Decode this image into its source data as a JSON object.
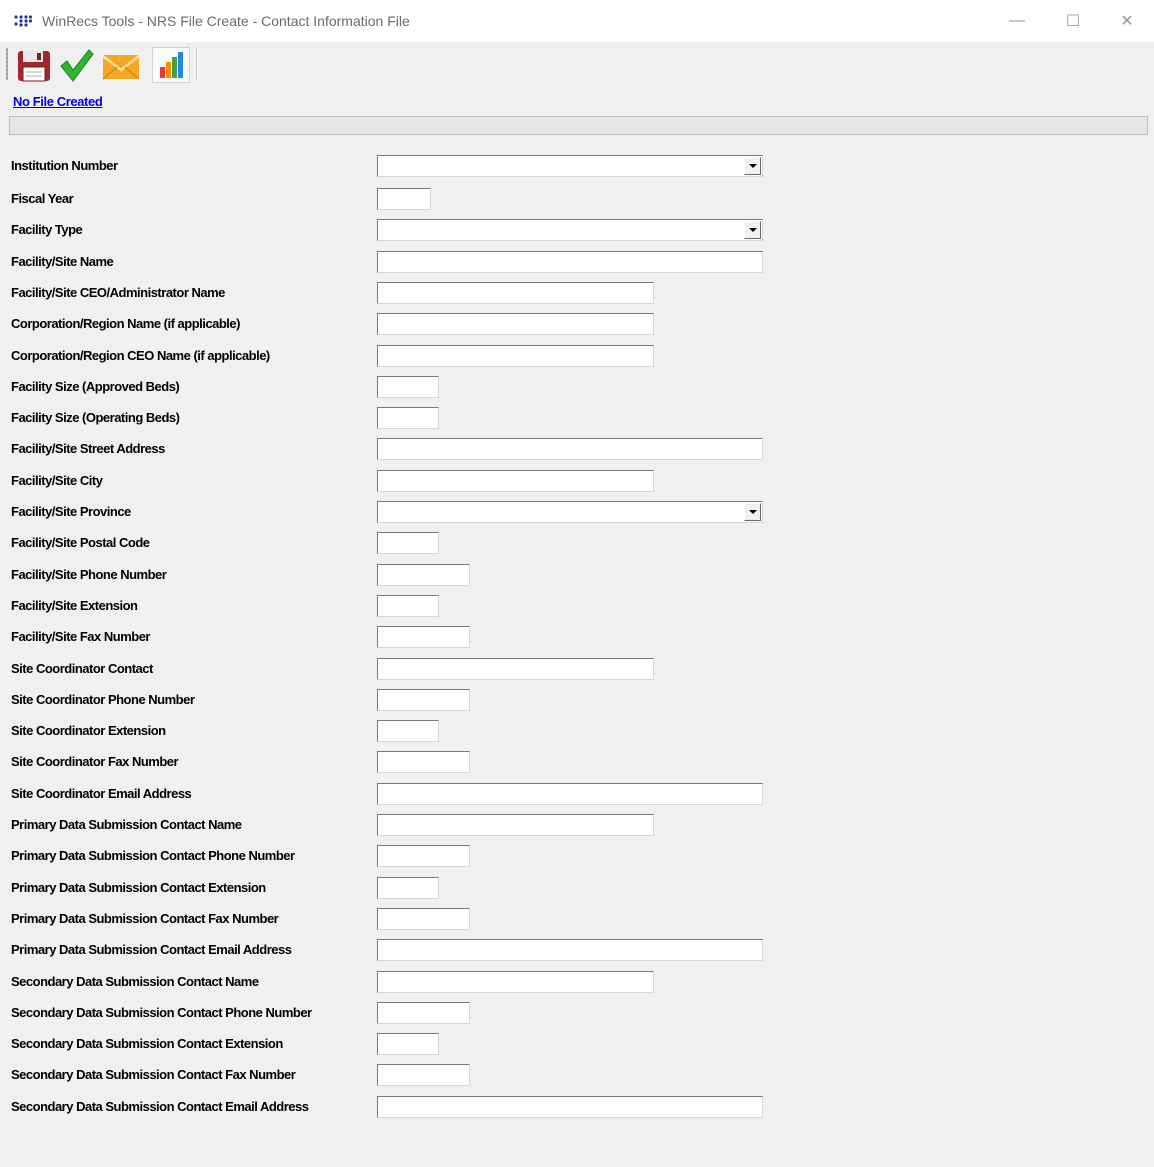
{
  "window": {
    "title": "WinRecs Tools - NRS File Create - Contact Information File",
    "minimize_glyph": "—",
    "maximize_glyph": "☐",
    "close_glyph": "✕"
  },
  "toolbar": {
    "buttons": [
      {
        "name": "save",
        "icon": "floppy-disk-icon"
      },
      {
        "name": "validate",
        "icon": "checkmark-icon"
      },
      {
        "name": "email",
        "icon": "envelope-icon"
      },
      {
        "name": "report",
        "icon": "bar-chart-icon"
      }
    ]
  },
  "status": {
    "link_text": "No File Created"
  },
  "form": {
    "fields": [
      {
        "label": "Institution Number",
        "value": ""
      },
      {
        "label": "Fiscal Year",
        "value": ""
      },
      {
        "label": "Facility Type",
        "value": ""
      },
      {
        "label": "Facility/Site Name",
        "value": ""
      },
      {
        "label": "Facility/Site CEO/Administrator Name",
        "value": ""
      },
      {
        "label": "Corporation/Region Name (if applicable)",
        "value": ""
      },
      {
        "label": "Corporation/Region CEO Name (if applicable)",
        "value": ""
      },
      {
        "label": "Facility Size (Approved Beds)",
        "value": ""
      },
      {
        "label": "Facility Size (Operating Beds)",
        "value": ""
      },
      {
        "label": "Facility/Site Street Address",
        "value": ""
      },
      {
        "label": "Facility/Site City",
        "value": ""
      },
      {
        "label": "Facility/Site Province",
        "value": ""
      },
      {
        "label": "Facility/Site Postal Code",
        "value": ""
      },
      {
        "label": "Facility/Site Phone Number",
        "value": ""
      },
      {
        "label": "Facility/Site Extension",
        "value": ""
      },
      {
        "label": "Facility/Site Fax Number",
        "value": ""
      },
      {
        "label": "Site Coordinator Contact",
        "value": ""
      },
      {
        "label": "Site Coordinator Phone Number",
        "value": ""
      },
      {
        "label": "Site Coordinator Extension",
        "value": ""
      },
      {
        "label": "Site Coordinator Fax Number",
        "value": ""
      },
      {
        "label": "Site Coordinator Email Address",
        "value": ""
      },
      {
        "label": "Primary Data Submission Contact Name",
        "value": ""
      },
      {
        "label": "Primary Data Submission Contact Phone Number",
        "value": ""
      },
      {
        "label": "Primary Data Submission Contact Extension",
        "value": ""
      },
      {
        "label": "Primary Data Submission Contact Fax Number",
        "value": ""
      },
      {
        "label": "Primary Data Submission Contact Email Address",
        "value": ""
      },
      {
        "label": "Secondary Data Submission Contact Name",
        "value": ""
      },
      {
        "label": "Secondary Data Submission Contact Phone Number",
        "value": ""
      },
      {
        "label": "Secondary Data Submission Contact Extension",
        "value": ""
      },
      {
        "label": "Secondary Data Submission Contact Fax Number",
        "value": ""
      },
      {
        "label": "Secondary Data Submission Contact Email Address",
        "value": ""
      }
    ]
  },
  "colors": {
    "window_bg": "#f0f0f0",
    "link": "#0000ee",
    "save_icon": "#a0282d",
    "check_icon": "#2fb52f",
    "email_icon": "#f5a623"
  }
}
